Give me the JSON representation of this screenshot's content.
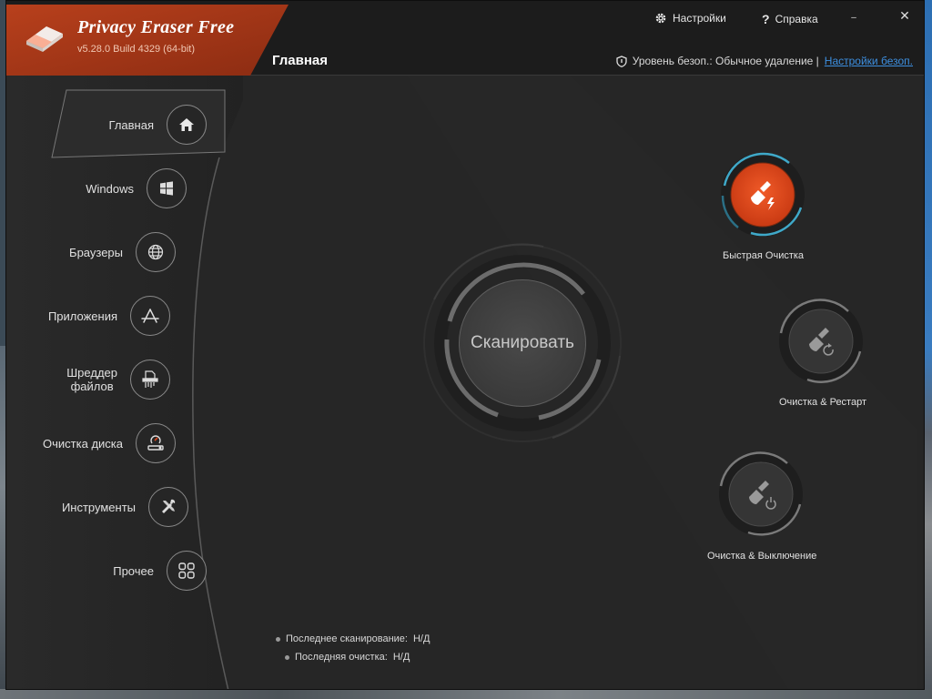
{
  "app": {
    "title": "Privacy Eraser Free",
    "version": "v5.28.0 Build 4329 (64-bit)"
  },
  "topbar": {
    "settings_label": "Настройки",
    "help_label": "Справка",
    "minimize_glyph": "–",
    "close_glyph": "✕"
  },
  "page": {
    "title": "Главная"
  },
  "security": {
    "label": "Уровень безоп.: Обычное удаление |",
    "link": "Настройки безоп."
  },
  "sidebar": {
    "items": [
      {
        "label": "Главная",
        "icon": "home-icon"
      },
      {
        "label": "Windows",
        "icon": "windows-icon"
      },
      {
        "label": "Браузеры",
        "icon": "globe-icon"
      },
      {
        "label": "Приложения",
        "icon": "app-store-icon"
      },
      {
        "label": "Шреддер файлов",
        "label_line1": "Шреддер",
        "label_line2": "файлов",
        "icon": "shredder-icon"
      },
      {
        "label": "Очистка диска",
        "icon": "disk-cleanup-icon"
      },
      {
        "label": "Инструменты",
        "icon": "tools-icon"
      },
      {
        "label": "Прочее",
        "icon": "grid-icon"
      }
    ]
  },
  "scan": {
    "label": "Сканировать"
  },
  "quick_actions": {
    "quick_clean": "Быстрая Очистка",
    "clean_restart": "Очистка & Рестарт",
    "clean_shutdown": "Очистка & Выключение"
  },
  "stats": {
    "last_scan_label": "Последнее сканирование:",
    "last_scan_value": "Н/Д",
    "last_clean_label": "Последняя очистка:",
    "last_clean_value": "Н/Д"
  },
  "colors": {
    "accent": "#d9441a",
    "brand_bg": "#a43519",
    "ring_glow": "#3fa9c9",
    "link": "#3d8fe0"
  }
}
